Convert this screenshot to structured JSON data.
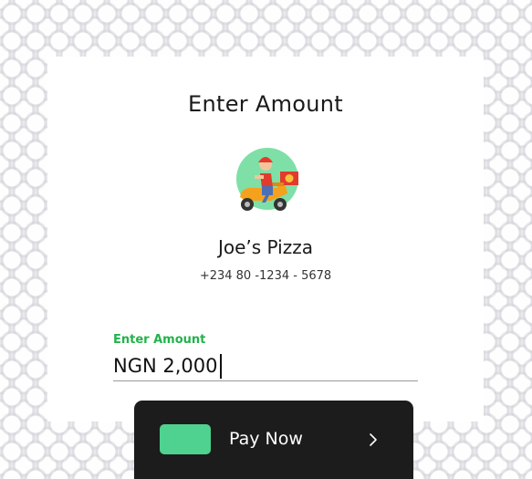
{
  "page": {
    "title": "Enter Amount"
  },
  "merchant": {
    "name": "Joe’s Pizza",
    "phone": "+234 80 -1234 - 5678",
    "avatar_icon": "delivery-scooter-icon"
  },
  "amount_field": {
    "label": "Enter Amount",
    "value": "NGN 2,000"
  },
  "pay_button": {
    "label": "Pay Now",
    "icon": "chevron-right-icon",
    "swatch_color": "#4fd18f"
  },
  "colors": {
    "accent": "#21b34a",
    "button_bg": "#1c1c1c"
  }
}
